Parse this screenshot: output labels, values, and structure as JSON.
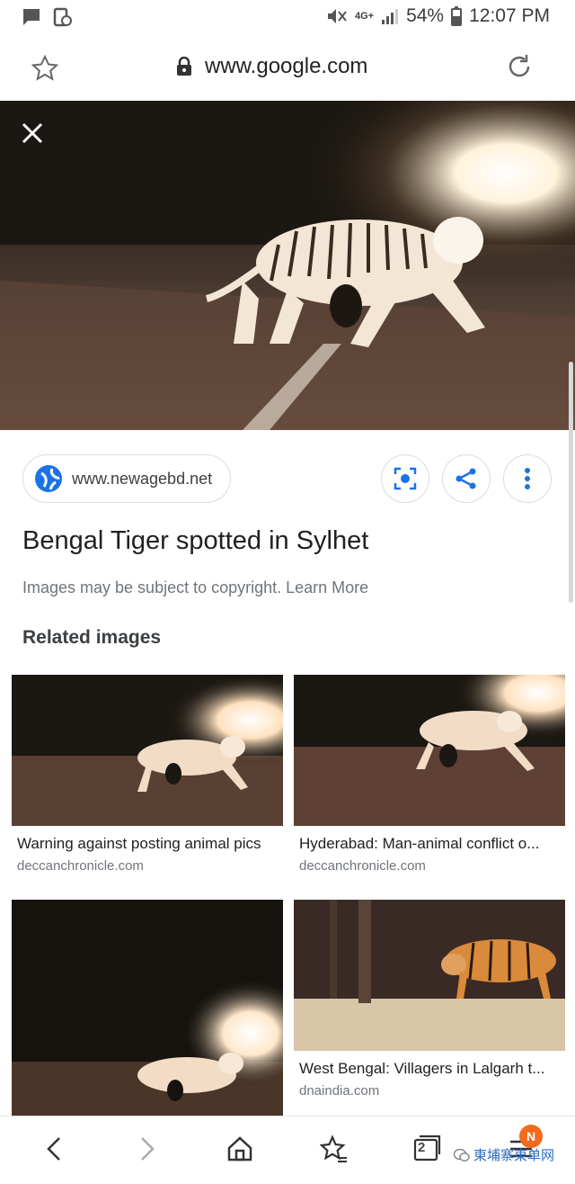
{
  "status_bar": {
    "network": "4G+",
    "battery": "54%",
    "time": "12:07 PM"
  },
  "browser": {
    "url": "www.google.com",
    "tab_count": "2",
    "menu_badge": "N"
  },
  "viewer": {
    "source_domain": "www.newagebd.net",
    "title": "Bengal Tiger spotted in Sylhet",
    "copyright_notice": "Images may be subject to copyright. Learn More",
    "related_heading": "Related images"
  },
  "related": [
    {
      "title": "Warning against posting animal pics",
      "domain": "deccanchronicle.com"
    },
    {
      "title": "Hyderabad: Man-animal conflict o...",
      "domain": "deccanchronicle.com"
    },
    {
      "title": "",
      "domain": ""
    },
    {
      "title": "West Bengal: Villagers in Lalgarh t...",
      "domain": "dnaindia.com"
    }
  ],
  "watermark": "東埔寨東单网",
  "colors": {
    "accent_blue": "#1a73e8",
    "badge_orange": "#f26a1b"
  }
}
